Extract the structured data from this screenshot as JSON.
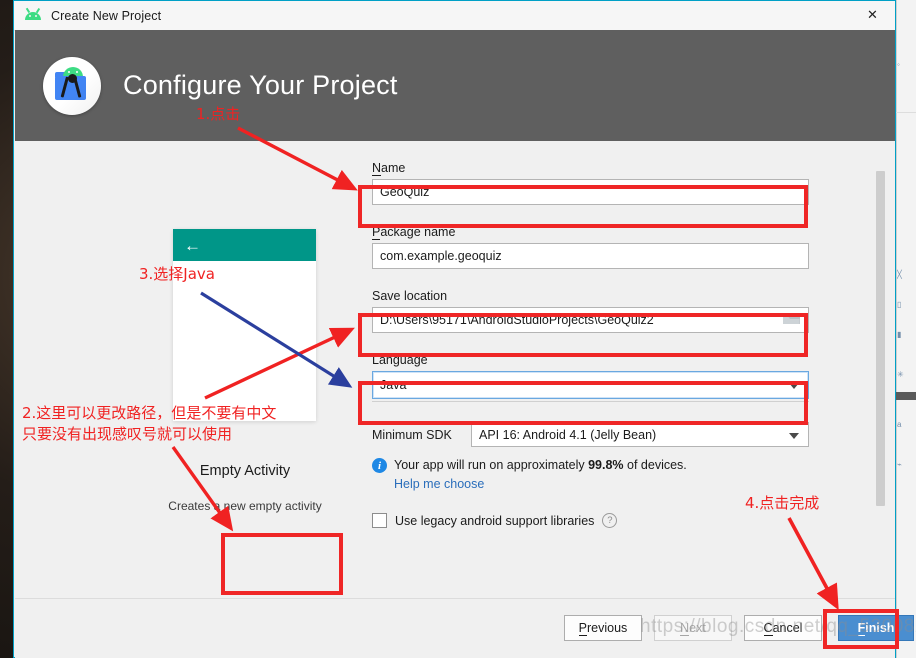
{
  "window": {
    "title": "Create New Project",
    "app_icon": "android-head-icon",
    "close_label": "✕"
  },
  "header": {
    "title": "Configure Your Project",
    "logo_icon": "android-studio-logo-icon"
  },
  "preview": {
    "back_icon": "←",
    "template_name": "Empty Activity",
    "template_description": "Creates a new empty activity"
  },
  "form": {
    "name": {
      "label": "Name",
      "accel": "N",
      "value": "GeoQuiz"
    },
    "package_name": {
      "label": "Package name",
      "accel": "P",
      "value": "com.example.geoquiz"
    },
    "save_location": {
      "label": "Save location",
      "value": "D:\\Users\\95171\\AndroidStudioProjects\\GeoQuiz2",
      "browse_icon": "folder-icon"
    },
    "language": {
      "label": "Language",
      "value": "Java",
      "caret_icon": "chevron-down-icon"
    },
    "minimum_sdk": {
      "label": "Minimum SDK",
      "value": "API 16: Android 4.1 (Jelly Bean)",
      "caret_icon": "chevron-down-icon"
    },
    "device_info": {
      "icon": "info-icon",
      "prefix": "Your app will run on approximately ",
      "percent": "99.8%",
      "suffix": " of devices.",
      "link": "Help me choose"
    },
    "legacy_checkbox": {
      "label": "Use legacy android support libraries",
      "checked": false,
      "help_icon": "question-mark-icon"
    }
  },
  "footer": {
    "previous": {
      "label": "Previous",
      "accel": "P",
      "enabled": true
    },
    "next": {
      "label": "Next",
      "accel": "N",
      "enabled": false
    },
    "cancel": {
      "label": "Cancel",
      "accel": "C",
      "enabled": true
    },
    "finish": {
      "label": "Finish",
      "accel": "F",
      "enabled": true,
      "primary": true
    }
  },
  "annotations": {
    "step1": "1.点击",
    "step2_line1": "2.这里可以更改路径，但是不要有中文",
    "step2_line2": "只要没有出现感叹号就可以使用",
    "step3": "3.选择Java",
    "step4": "4.点击完成",
    "color": "#f02222",
    "blue_arrow_color": "#2b3f9e"
  },
  "watermark": {
    "text": "https://blog.csdn.net/qq_53008229"
  },
  "background": {
    "side_strip_lines": [
      "文",
      "档",
      "表",
      "格",
      "设",
      "置",
      "工",
      "具"
    ]
  }
}
